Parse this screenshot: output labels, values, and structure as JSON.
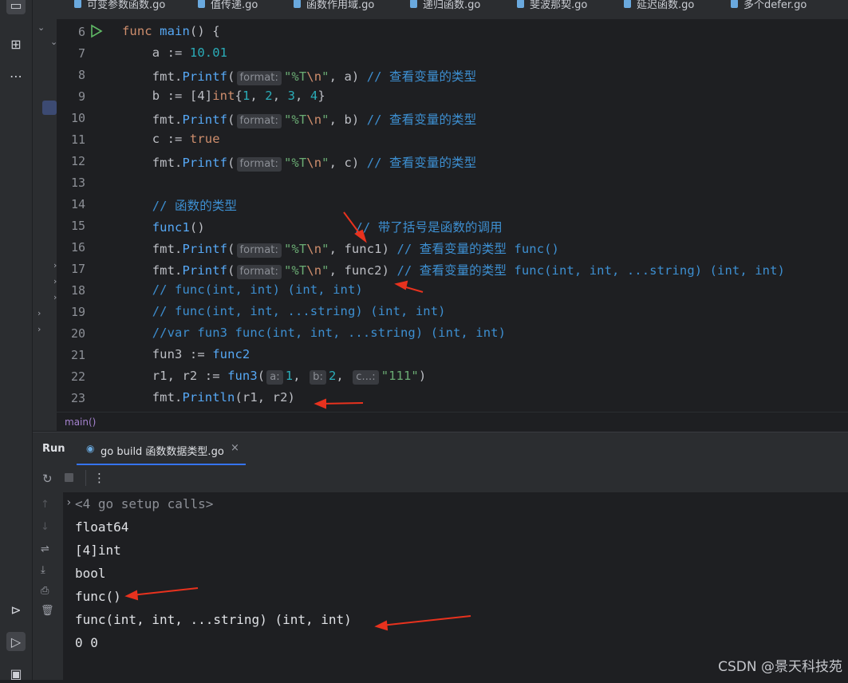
{
  "tabs": [
    "可变参数函数.go",
    "值传递.go",
    "函数作用域.go",
    "递归函数.go",
    "斐波那契.go",
    "延迟函数.go",
    "多个defer.go"
  ],
  "editor": {
    "lines": [
      {
        "n": "6"
      },
      {
        "n": "7"
      },
      {
        "n": "8"
      },
      {
        "n": "9"
      },
      {
        "n": "10"
      },
      {
        "n": "11"
      },
      {
        "n": "12"
      },
      {
        "n": "13"
      },
      {
        "n": "14"
      },
      {
        "n": "15"
      },
      {
        "n": "16"
      },
      {
        "n": "17"
      },
      {
        "n": "18"
      },
      {
        "n": "19"
      },
      {
        "n": "20"
      },
      {
        "n": "21"
      },
      {
        "n": "22"
      },
      {
        "n": "23"
      }
    ],
    "code": {
      "l6_kw": "func",
      "l6_name": "main",
      "l6_rest": "() {",
      "l7_a": "a := ",
      "l7_num": "10.01",
      "printf_pkg": "fmt.",
      "printf_fn": "Printf",
      "paren_open": "(",
      "hint_format": "format:",
      "fmt_str_q1": "\"%T",
      "fmt_str_esc": "\\n",
      "fmt_str_q2": "\"",
      "l8_arg": ", a) ",
      "comment_type": "// 查看变量的类型",
      "l9_a": "b := [4]",
      "l9_int": "int",
      "l9_b": "{",
      "l9_n1": "1",
      "l9_c1": ", ",
      "l9_n2": "2",
      "l9_c2": ", ",
      "l9_n3": "3",
      "l9_c3": ", ",
      "l9_n4": "4",
      "l9_end": "}",
      "l10_arg": ", b) ",
      "l11_a": "c := ",
      "l11_kw": "true",
      "l12_arg": ", c) ",
      "l14": "// 函数的类型",
      "l15_fn": "func1",
      "l15_par": "()",
      "l15_sp": "                    ",
      "l15_cm": "// 带了括号是函数的调用",
      "l16_arg": ", func1) ",
      "l16_cm": "// 查看变量的类型 func()",
      "l17_arg": ", func2) ",
      "l17_cm": "// 查看变量的类型 func(int, int, ...string) (int, int)",
      "l18": "// func(int, int) (int, int)",
      "l19": "// func(int, int, ...string) (int, int)",
      "l20": "//var fun3 func(int, int, ...string) (int, int)",
      "l21_a": "fun3 := ",
      "l21_fn": "func2",
      "l22_a": "r1, r2 := ",
      "l22_fn": "fun3",
      "l22_po": "(",
      "hint_a": "a:",
      "l22_n1": "1",
      "l22_c": ", ",
      "hint_b": "b:",
      "l22_n2": "2",
      "hint_c": "c...:",
      "l22_str": "\"111\"",
      "l22_pc": ")",
      "l23_pkg": "fmt.",
      "l23_fn": "Println",
      "l23_args": "(r1, r2)"
    }
  },
  "breadcrumb": "main()",
  "run_panel": {
    "title": "Run",
    "tab_label": "go build 函数数据类型.go",
    "collapsed": "<4 go setup calls>",
    "output": [
      "float64",
      "[4]int",
      "bool",
      "func()",
      "func(int, int, ...string) (int, int)",
      "0 0"
    ]
  },
  "watermark": "CSDN @景天科技苑",
  "icons": {
    "project": "project-icon",
    "structure": "structure-icon",
    "more": "more-icon",
    "services": "services-icon",
    "run": "run-icon",
    "terminal": "terminal-icon",
    "rerun": "rerun-icon",
    "stop": "stop-icon",
    "kebab": "kebab-icon",
    "up": "arrow-up-icon",
    "down": "arrow-down-icon",
    "wrap": "soft-wrap-icon",
    "scroll": "scroll-to-end-icon",
    "print": "print-icon",
    "trash": "trash-icon"
  },
  "colors": {
    "background": "#1e1f22",
    "panel": "#2b2d30",
    "arrow": "#e8321e"
  }
}
